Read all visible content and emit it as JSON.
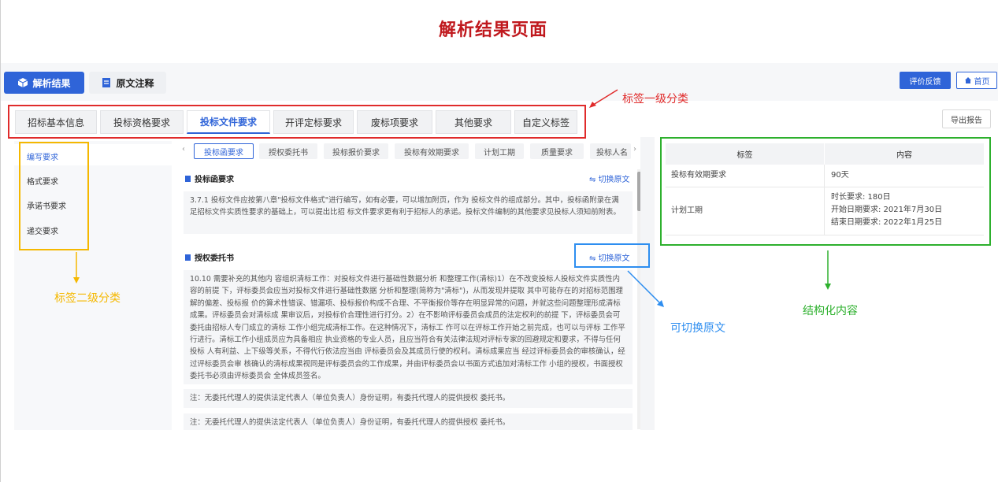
{
  "page_title": "解析结果页面",
  "topbar": {
    "tab_result": "解析结果",
    "tab_annotation": "原文注释",
    "btn_feedback": "评价反馈",
    "btn_home": "首页"
  },
  "level1_tabs": [
    "招标基本信息",
    "投标资格要求",
    "投标文件要求",
    "开评定标要求",
    "废标项要求",
    "其他要求",
    "自定义标签"
  ],
  "level1_active": "投标文件要求",
  "export_label": "导出报告",
  "level2_items": [
    "编写要求",
    "格式要求",
    "承诺书要求",
    "递交要求"
  ],
  "level2_active": "编写要求",
  "chips": [
    "投标函要求",
    "授权委托书",
    "投标报价要求",
    "投标有效期要求",
    "计划工期",
    "质量要求",
    "投标人名"
  ],
  "chip_active": "投标函要求",
  "sections": [
    {
      "title": "投标函要求",
      "switch_label": "切换原文",
      "text": "3.7.1 投标文件应按第八章\"投标文件格式\"进行编写，如有必要，可以增加附页，作为 投标文件的组成部分。其中，投标函附录在满足招标文件实质性要求的基础上，可以提出比招 标文件要求更有利于招标人的承诺。投标文件编制的其他要求见投标人须知前附表。"
    },
    {
      "title": "授权委托书",
      "switch_label": "切换原文",
      "text": "10.10 需要补充的其他内 容组织清标工作：对投标文件进行基础性数据分析 和整理工作(清标)1）在不改变投标人投标文件实质性内容的前提 下，评标委员会应当对投标文件进行基础性数据 分析和整理(简称为\"清标\")，从而发现并提取 其中可能存在的对招标范围理解的偏差、投标报 价的算术性错误、错漏项、投标报价构成不合理、不平衡报价等存在明显异常的问题，并就这些问题整理形成清标成果。评标委员会对清标成 果审议后，对投标价合理性进行打分。2）在不影响评标委员会成员的法定权利的前提 下，评标委员会可委托由招标人专门成立的清标 工作小组完成清标工作。在这种情况下，清标工 作可以在评标工作开始之前完成，也可以与评标 工作平行进行。清标工作小组成员应为具备相应 执业资格的专业人员，且应当符合有关法律法规对评标专家的回避规定和要求，不得与任何投标 人有利益、上下级等关系，不得代行依法应当由 评标委员会及其成员行使的权利。清标成果应当 经过评标委员会的审核确认，经过评标委员会审 核确认的清标成果视同是评标委员会的工作成果，并由评标委员会以书面方式追加对清标工作 小组的授权，书面授权委托书必须由评标委员会 全体成员签名。",
      "notes": [
        "注：无委托代理人的提供法定代表人（单位负责人）身份证明，有委托代理人的提供授权 委托书。",
        "注：无委托代理人的提供法定代表人（单位负责人）身份证明，有委托代理人的提供授权 委托书。"
      ]
    }
  ],
  "table": {
    "headers": [
      "标签",
      "内容"
    ],
    "rows": [
      {
        "label": "投标有效期要求",
        "lines": [
          "90天"
        ]
      },
      {
        "label": "计划工期",
        "lines": [
          "时长要求: 180日",
          "开始日期要求: 2021年7月30日",
          "结束日期要求: 2022年1月25日"
        ]
      }
    ]
  },
  "annotations": {
    "level1": "标签一级分类",
    "level2": "标签二级分类",
    "switch": "可切换原文",
    "structured": "结构化内容"
  },
  "colors": {
    "primary": "#2f64d8",
    "title_red": "#c0191e",
    "red": "#e02b2b",
    "yellow": "#f5b800",
    "blue": "#2e8ef0",
    "green": "#2db02d"
  }
}
